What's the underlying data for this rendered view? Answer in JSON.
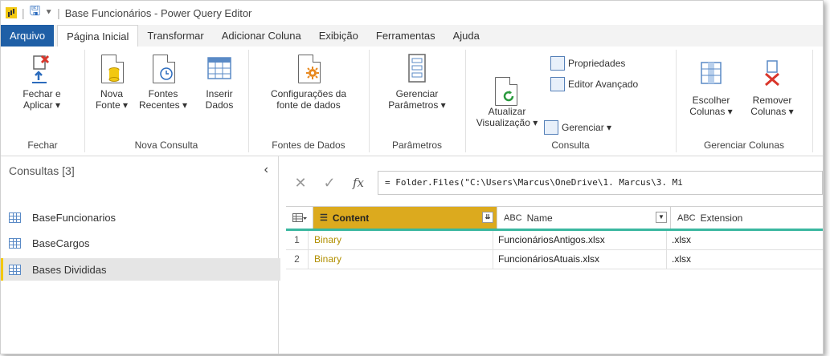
{
  "window": {
    "title": "Base Funcionários - Power Query Editor"
  },
  "tabs": [
    {
      "label": "Arquivo"
    },
    {
      "label": "Página Inicial"
    },
    {
      "label": "Transformar"
    },
    {
      "label": "Adicionar Coluna"
    },
    {
      "label": "Exibição"
    },
    {
      "label": "Ferramentas"
    },
    {
      "label": "Ajuda"
    }
  ],
  "ribbon": {
    "fechar": {
      "btn_line1": "Fechar e",
      "btn_line2": "Aplicar ▾",
      "group": "Fechar"
    },
    "nova_consulta": {
      "nova_fonte": {
        "line1": "Nova",
        "line2": "Fonte ▾"
      },
      "fontes_recentes": {
        "line1": "Fontes",
        "line2": "Recentes ▾"
      },
      "inserir_dados": {
        "line1": "Inserir",
        "line2": "Dados"
      },
      "group": "Nova Consulta"
    },
    "fontes_dados": {
      "line1": "Configurações da",
      "line2": "fonte de dados",
      "group": "Fontes de Dados"
    },
    "parametros": {
      "line1": "Gerenciar",
      "line2": "Parâmetros ▾",
      "group": "Parâmetros"
    },
    "consulta": {
      "atualizar": {
        "line1": "Atualizar",
        "line2": "Visualização ▾"
      },
      "propriedades": "Propriedades",
      "editor_avancado": "Editor Avançado",
      "gerenciar": "Gerenciar ▾",
      "group": "Consulta"
    },
    "colunas": {
      "escolher": {
        "line1": "Escolher",
        "line2": "Colunas ▾"
      },
      "remover": {
        "line1": "Remover",
        "line2": "Colunas ▾"
      },
      "group": "Gerenciar Colunas"
    }
  },
  "queries": {
    "header": "Consultas [3]",
    "items": [
      {
        "label": "BaseFuncionarios"
      },
      {
        "label": "BaseCargos"
      },
      {
        "label": "Bases Divididas"
      }
    ]
  },
  "formula": {
    "text": "= Folder.Files(\"C:\\Users\\Marcus\\OneDrive\\1. Marcus\\3. Mi"
  },
  "grid": {
    "columns": [
      {
        "type": "☰",
        "label": "Content"
      },
      {
        "type": "ABC",
        "label": "Name"
      },
      {
        "type": "ABC",
        "label": "Extension"
      }
    ],
    "rows": [
      {
        "num": "1",
        "content": "Binary",
        "name": "FuncionáriosAntigos.xlsx",
        "ext": ".xlsx"
      },
      {
        "num": "2",
        "content": "Binary",
        "name": "FuncionáriosAtuais.xlsx",
        "ext": ".xlsx"
      }
    ]
  }
}
